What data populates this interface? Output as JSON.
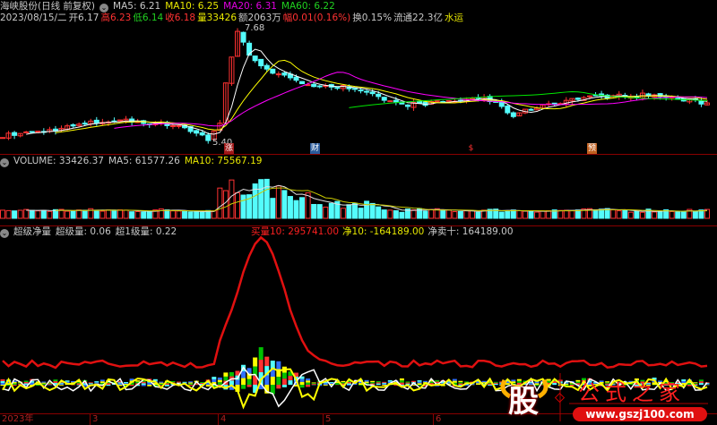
{
  "header": {
    "stock": "海峡股份(日线 前复权)",
    "ma5": "MA5: 6.21",
    "ma10": "MA10: 6.25",
    "ma20": "MA20: 6.31",
    "ma60": "MA60: 6.22",
    "date": "2023/08/15/二",
    "open": "开6.17",
    "high": "高6.23",
    "low": "低6.14",
    "close": "收6.18",
    "vol": "量33426",
    "amount": "额2063万",
    "change": "幅0.01(0.16%)",
    "turnover": "换0.15%",
    "float": "流通22.3亿",
    "sector": "水运",
    "max_label": "7.68",
    "min_label": "5.40"
  },
  "markers": {
    "zhang": "涨",
    "cai": "财",
    "dollar": "$",
    "yu": "预"
  },
  "volume": {
    "label": "VOLUME: 33426.37",
    "ma5": "MA5: 61577.26",
    "ma10": "MA10: 75567.19"
  },
  "indicator": {
    "name": "超级净量",
    "super": "超级量: 0.06",
    "super1": "超1级量: 0.22",
    "buy10": "买量10: 295741.00",
    "net10": "净10: -164189.00",
    "netsell": "净卖十: 164189.00"
  },
  "axis": {
    "year": "2023年",
    "m3": "3",
    "m4": "4",
    "m5": "5",
    "m6": "6"
  },
  "logo": {
    "glyph": "股",
    "title": "公式之家",
    "url": "www.gszj100.com"
  },
  "colors": {
    "up": "#ff3232",
    "down": "#54fcfc",
    "ma5": "#ffffff",
    "ma10": "#ffff00",
    "ma20": "#ff00ff",
    "ma60": "#00e600",
    "grid": "#8a0000"
  },
  "chart_data": {
    "type": "candlestick",
    "price_keypoints": [
      [
        0,
        5.55
      ],
      [
        8,
        5.65
      ],
      [
        15,
        5.8
      ],
      [
        20,
        5.85
      ],
      [
        30,
        5.75
      ],
      [
        34,
        5.55
      ],
      [
        35,
        5.45
      ],
      [
        37,
        5.8
      ],
      [
        38,
        6.6
      ],
      [
        39,
        7.1
      ],
      [
        40,
        7.6
      ],
      [
        42,
        7.1
      ],
      [
        46,
        6.8
      ],
      [
        50,
        6.6
      ],
      [
        53,
        6.55
      ],
      [
        58,
        6.5
      ],
      [
        64,
        6.3
      ],
      [
        68,
        6.15
      ],
      [
        75,
        6.2
      ],
      [
        82,
        6.3
      ],
      [
        87,
        5.95
      ],
      [
        92,
        6.15
      ],
      [
        99,
        6.3
      ],
      [
        110,
        6.35
      ],
      [
        120,
        6.18
      ]
    ],
    "price_range": [
      5.4,
      7.68
    ]
  }
}
